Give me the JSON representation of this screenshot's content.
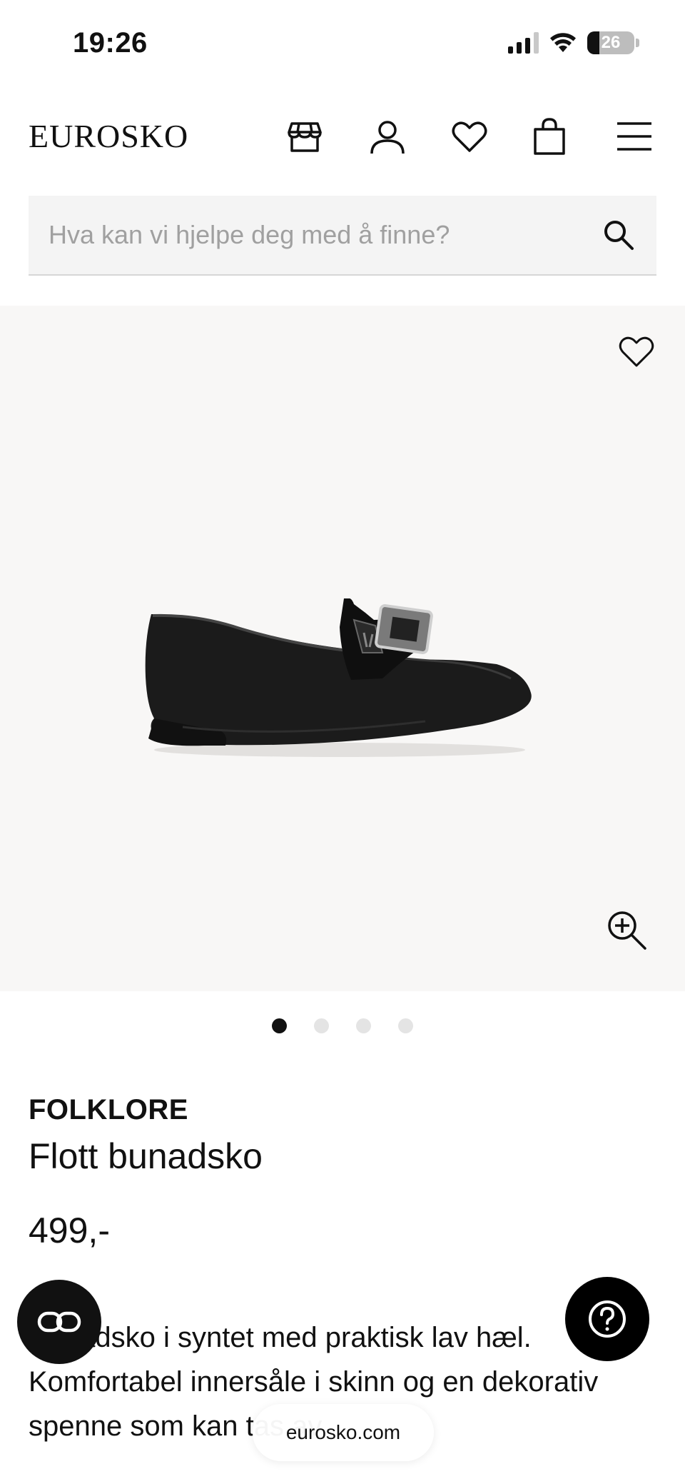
{
  "status_bar": {
    "time": "19:26",
    "battery": "26"
  },
  "header": {
    "logo": "EUROSKO",
    "icons": [
      "store-icon",
      "user-icon",
      "heart-icon",
      "shopping-bag-icon",
      "menu-icon"
    ]
  },
  "search": {
    "placeholder": "Hva kan vi hjelpe deg med å finne?"
  },
  "gallery": {
    "image_count": 4,
    "active_index": 0
  },
  "product": {
    "brand": "FOLKLORE",
    "name": "Flott bunadsko",
    "price": "499,-",
    "description": "Bunadsko i syntet med praktisk lav hæl. Komfortabel innersåle i skinn og en dekorativ spenne som kan tas av."
  },
  "browser": {
    "url": "eurosko.com"
  },
  "colors": {
    "background": "#ffffff",
    "gallery_bg": "#f8f7f6",
    "text": "#111111",
    "search_bg": "#f4f4f4"
  }
}
